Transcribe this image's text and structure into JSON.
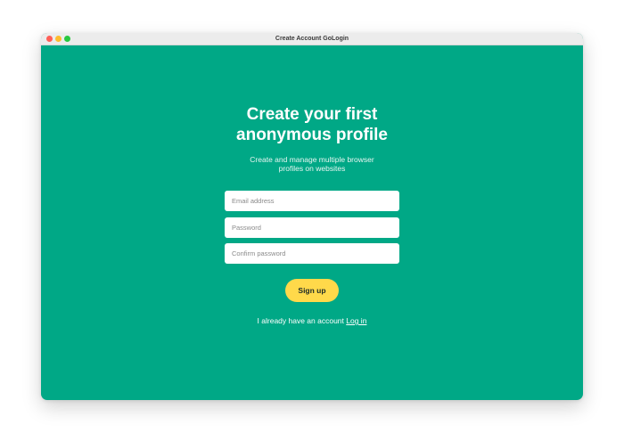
{
  "window": {
    "title": "Create Account GoLogin"
  },
  "form": {
    "heading_line1": "Create your first",
    "heading_line2": "anonymous profile",
    "subtitle_line1": "Create and manage multiple browser",
    "subtitle_line2": "profiles on websites",
    "email_placeholder": "Email address",
    "email_value": "",
    "password_placeholder": "Password",
    "password_value": "",
    "confirm_placeholder": "Confirm password",
    "confirm_value": "",
    "signup_label": "Sign up",
    "login_prompt": "I already have an account",
    "login_link": "Log in"
  },
  "colors": {
    "background": "#00a886",
    "button": "#ffd94a",
    "titlebar": "#ececec"
  },
  "icons": [
    "close-window-icon",
    "minimize-window-icon",
    "zoom-window-icon"
  ]
}
